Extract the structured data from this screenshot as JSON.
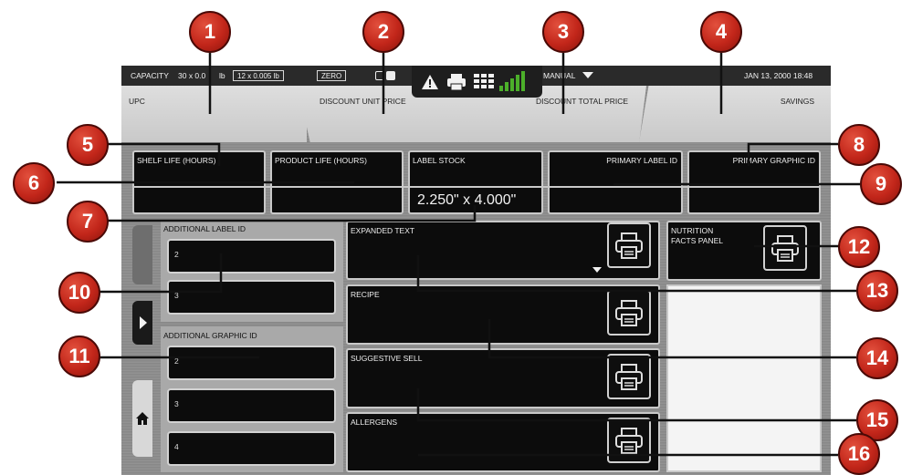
{
  "status_bar": {
    "capacity_label": "CAPACITY",
    "capacity_value": "30 x 0.0",
    "capacity_unit": "lb",
    "increment": "12 x 0.005 lb",
    "zero_label": "ZERO",
    "mode_label": "MANUAL",
    "datetime": "JAN 13, 2000 18:48"
  },
  "tabs": {
    "upc": "UPC",
    "discount_unit_price": "DISCOUNT UNIT PRICE",
    "discount_total_price": "DISCOUNT TOTAL PRICE",
    "savings": "SAVINGS"
  },
  "fields": {
    "shelf_life": "SHELF LIFE (HOURS)",
    "product_life": "PRODUCT LIFE (HOURS)",
    "label_stock": "LABEL STOCK",
    "label_stock_value": "2.250\" x 4.000\"",
    "primary_label_id": "PRIMARY LABEL ID",
    "primary_graphic_id": "PRIMARY GRAPHIC ID",
    "additional_label_id": "ADDITIONAL LABEL ID",
    "additional_label_rows": [
      "2",
      "3"
    ],
    "additional_graphic_id": "ADDITIONAL GRAPHIC ID",
    "additional_graphic_rows": [
      "2",
      "3",
      "4"
    ],
    "expanded_text": "EXPANDED TEXT",
    "recipe": "RECIPE",
    "suggestive_sell": "SUGGESTIVE SELL",
    "allergens": "ALLERGENS",
    "nutrition_line1": "NUTRITION",
    "nutrition_line2": "FACTS PANEL"
  },
  "callouts": [
    "1",
    "2",
    "3",
    "4",
    "5",
    "6",
    "7",
    "8",
    "9",
    "10",
    "11",
    "12",
    "13",
    "14",
    "15",
    "16"
  ],
  "colors": {
    "callout_red": "#c2261a",
    "field_black": "#0c0c0c",
    "tab_gray": "#d4d4d4",
    "signal_green": "#4caf2a"
  },
  "icons": [
    "warning-icon",
    "printer-icon",
    "grid-icon",
    "signal-icon",
    "chevron-down-icon",
    "chevron-right-icon",
    "home-icon"
  ]
}
